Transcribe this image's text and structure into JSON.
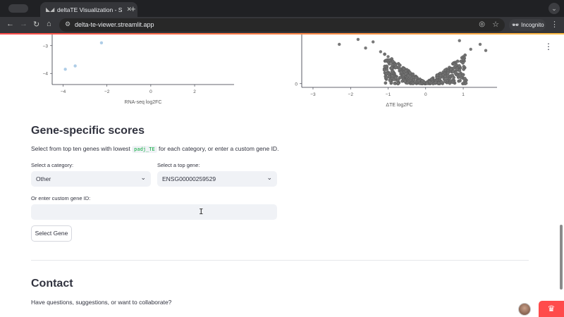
{
  "browser": {
    "tab_title": "deltaTE Visualization - Streamlit",
    "url": "delta-te-viewer.streamlit.app",
    "incognito_label": "Incognito"
  },
  "chart_data": [
    {
      "type": "scatter",
      "xlabel": "RNA-seq log2FC",
      "ylabel": "",
      "x_ticks": [
        "−4",
        "−2",
        "0",
        "2"
      ],
      "y_ticks": [
        "−3",
        "−4"
      ],
      "xlim": [
        -4.5,
        3.8
      ],
      "ylim": [
        -4.4,
        -2.6
      ],
      "points": [
        {
          "x": -3.9,
          "y": -3.85
        },
        {
          "x": -3.45,
          "y": -3.73
        },
        {
          "x": -2.25,
          "y": -2.9
        }
      ],
      "color": "#a5c8e4"
    },
    {
      "type": "scatter",
      "xlabel": "ΔTE log2FC",
      "ylabel": "",
      "x_ticks": [
        "−3",
        "−2",
        "−1",
        "0",
        "1"
      ],
      "y_ticks": [
        "0"
      ],
      "xlim": [
        -3.3,
        1.9
      ],
      "ylim": [
        -0.3,
        4
      ],
      "points": [
        {
          "x": -2.3,
          "y": 3.2
        },
        {
          "x": -1.6,
          "y": 2.9
        },
        {
          "x": -1.4,
          "y": 3.4
        },
        {
          "x": -1.2,
          "y": 2.6
        },
        {
          "x": -1.0,
          "y": 2.2
        },
        {
          "x": -0.8,
          "y": 1.6
        },
        {
          "x": -0.6,
          "y": 1.1
        },
        {
          "x": -0.4,
          "y": 0.6
        },
        {
          "x": -0.2,
          "y": 0.25
        },
        {
          "x": 0.0,
          "y": 0.05
        },
        {
          "x": 0.2,
          "y": 0.25
        },
        {
          "x": 0.4,
          "y": 0.6
        },
        {
          "x": 0.6,
          "y": 1.1
        },
        {
          "x": 0.8,
          "y": 1.6
        },
        {
          "x": 1.0,
          "y": 2.2
        },
        {
          "x": 1.2,
          "y": 2.8
        },
        {
          "x": 1.45,
          "y": 3.2
        },
        {
          "x": 1.6,
          "y": 2.7
        },
        {
          "x": -1.8,
          "y": 3.6
        },
        {
          "x": 0.9,
          "y": 3.5
        }
      ],
      "color": "#6a6a6a"
    }
  ],
  "gene_section": {
    "title": "Gene-specific scores",
    "intro_before": "Select from top ten genes with lowest ",
    "intro_code": "padj_TE",
    "intro_after": " for each category, or enter a custom gene ID.",
    "category_label": "Select a category:",
    "category_value": "Other",
    "gene_label": "Select a top gene:",
    "gene_value": "ENSG00000259529",
    "custom_label": "Or enter custom gene ID:",
    "custom_value": "",
    "button_label": "Select Gene"
  },
  "contact": {
    "title": "Contact",
    "question": "Have questions, suggestions, or want to collaborate?"
  }
}
